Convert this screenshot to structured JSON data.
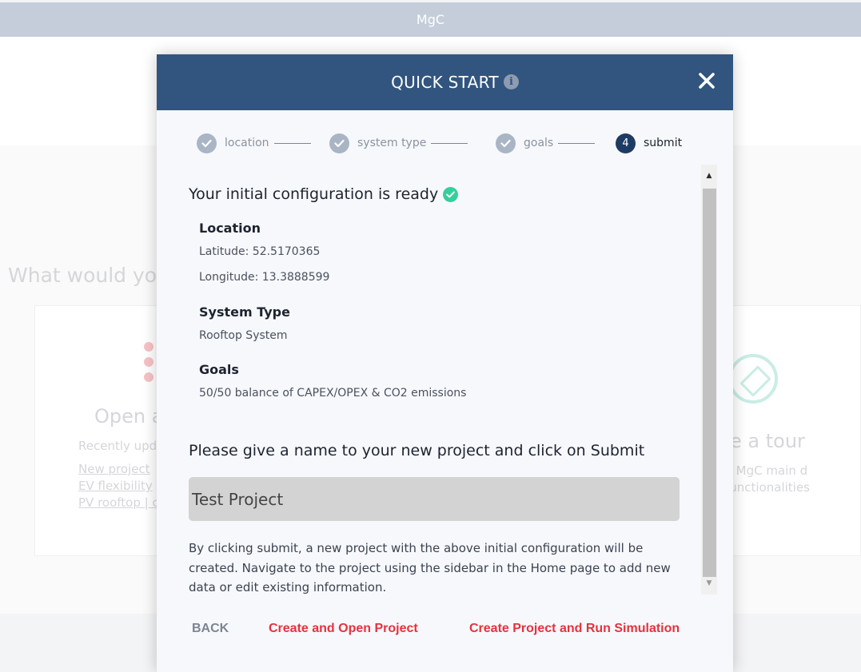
{
  "app": {
    "title": "MgC"
  },
  "background": {
    "heading": "What would yo",
    "open_card": {
      "title": "Open a",
      "subtitle": "Recently upd",
      "links": [
        "New project",
        "EV flexibility",
        "PV rooftop | c"
      ]
    },
    "tour_card": {
      "title": "e a tour",
      "subtitle": "y MgC main d functionalities"
    }
  },
  "modal": {
    "title": "QUICK START",
    "steps": [
      {
        "label": "location",
        "status": "done"
      },
      {
        "label": "system type",
        "status": "done"
      },
      {
        "label": "goals",
        "status": "done"
      },
      {
        "label": "submit",
        "number": "4",
        "status": "active"
      }
    ],
    "ready_text": "Your initial configuration is ready",
    "location": {
      "title": "Location",
      "latitude": "Latitude: 52.5170365",
      "longitude": "Longitude: 13.3888599"
    },
    "system_type": {
      "title": "System Type",
      "value": "Rooftop System"
    },
    "goals": {
      "title": "Goals",
      "value": "50/50 balance of CAPEX/OPEX & CO2 emissions"
    },
    "prompt": "Please give a name to your new project and click on Submit",
    "project_name": {
      "value": "Test Project",
      "placeholder": "Test Project"
    },
    "note": "By clicking submit, a new project with the above initial configuration will be created. Navigate to the project using the sidebar in the Home page to add new data or edit existing information.",
    "buttons": {
      "back": "BACK",
      "create_open": "Create and Open Project",
      "create_run": "Create Project and Run Simulation"
    }
  },
  "colors": {
    "header": "#31557e",
    "accent_red": "#e5323e",
    "success_green": "#36cf9c",
    "step_done": "#a9b5c5",
    "step_active": "#1e3b63"
  }
}
